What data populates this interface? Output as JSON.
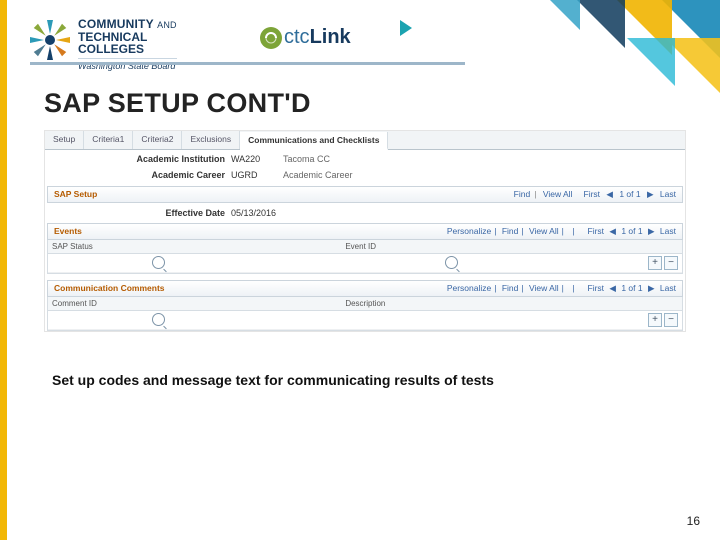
{
  "header": {
    "brand_top": "COMMUNITY",
    "brand_and": "AND",
    "brand_mid": "TECHNICAL",
    "brand_bot": "COLLEGES",
    "brand_sub": "Washington State Board",
    "ctc": "ctc",
    "link": "Link"
  },
  "title": "SAP SETUP CONT'D",
  "tabs": [
    "Setup",
    "Criteria1",
    "Criteria2",
    "Exclusions",
    "Communications and Checklists"
  ],
  "active_tab": 4,
  "info": {
    "inst_label": "Academic Institution",
    "inst_code": "WA220",
    "inst_desc": "Tacoma CC",
    "career_label": "Academic Career",
    "career_code": "UGRD",
    "career_desc": "Academic Career"
  },
  "sap": {
    "title": "SAP Setup",
    "find": "Find",
    "viewall": "View All",
    "first": "First",
    "pager": "1 of 1",
    "last": "Last",
    "eff_label": "Effective Date",
    "eff_value": "05/13/2016"
  },
  "events": {
    "title": "Events",
    "col1": "SAP Status",
    "col2": "Event ID",
    "personalize": "Personalize",
    "find": "Find",
    "viewall": "View All",
    "pager": "1 of 1",
    "first": "First",
    "last": "Last"
  },
  "comm": {
    "title": "Communication Comments",
    "col1": "Comment ID",
    "col2": "Description",
    "personalize": "Personalize",
    "find": "Find",
    "viewall": "View All",
    "pager": "1 of 1",
    "first": "First",
    "last": "Last"
  },
  "caption": "Set up codes and message text for communicating results of tests",
  "page_number": "16"
}
